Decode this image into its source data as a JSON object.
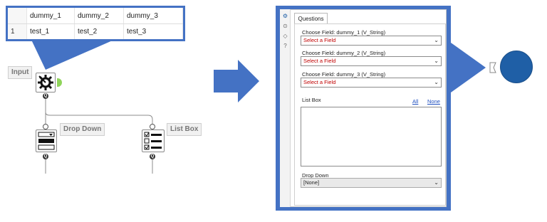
{
  "table": {
    "headers": [
      "",
      "dummy_1",
      "dummy_2",
      "dummy_3"
    ],
    "rows": [
      [
        "1",
        "test_1",
        "test_2",
        "test_3"
      ]
    ]
  },
  "workflow": {
    "input_label": "Input",
    "dropdown_label": "Drop Down",
    "listbox_label": "List Box",
    "anchor_q": "Q"
  },
  "panel": {
    "tab_label": "Questions",
    "fields": [
      {
        "label": "Choose Field: dummy_1 (V_String)",
        "value": "Select a Field"
      },
      {
        "label": "Choose Field: dummy_2 (V_String)",
        "value": "Select a Field"
      },
      {
        "label": "Choose Field: dummy_3 (V_String)",
        "value": "Select a Field"
      }
    ],
    "listbox_label": "List Box",
    "all_link": "All",
    "none_link": "None",
    "dropdown_label": "Drop Down",
    "dropdown_value": "[None]"
  },
  "colors": {
    "accent_blue": "#4472c4",
    "output_circle": "#1f5fa6",
    "select_placeholder": "#c00000"
  },
  "icons": [
    "gear-icon",
    "cog-small-icon",
    "tag-icon",
    "help-icon",
    "chevron-down-icon",
    "arrow-right-icon",
    "callout-icon",
    "checklist-icon"
  ]
}
